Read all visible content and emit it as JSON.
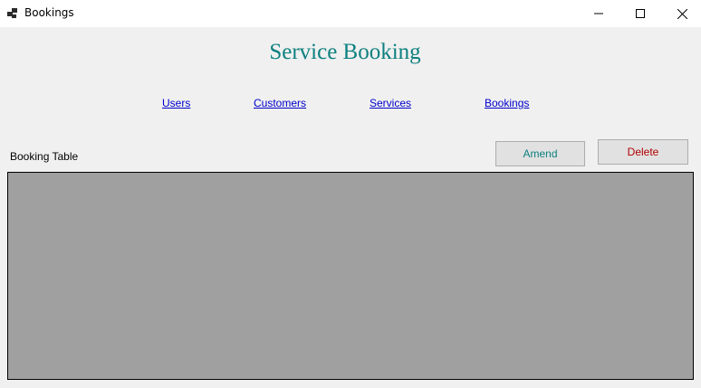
{
  "window": {
    "title": "Bookings",
    "controls": {
      "minimize_icon": "minimize-icon",
      "maximize_icon": "maximize-icon",
      "close_icon": "close-icon"
    }
  },
  "heading": "Service Booking",
  "nav": {
    "users": "Users",
    "customers": "Customers",
    "services": "Services",
    "bookings": "Bookings"
  },
  "table_label": "Booking Table",
  "buttons": {
    "amend": "Amend",
    "delete": "Delete"
  },
  "colors": {
    "heading": "#0f8080",
    "link": "#0000cc",
    "amend_text": "#0f8080",
    "delete_text": "#b00000",
    "grid_background": "#a0a0a0",
    "window_background": "#f0f0f0"
  }
}
